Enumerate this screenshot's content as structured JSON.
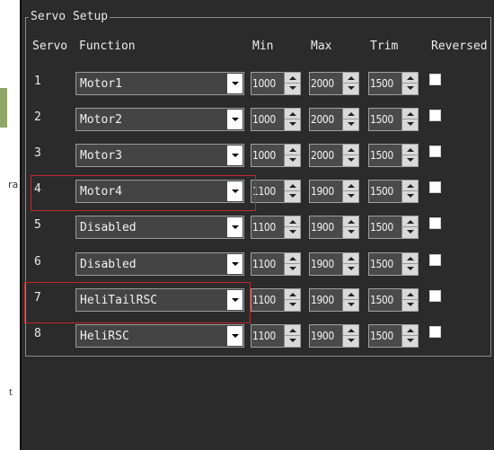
{
  "group_title": "Servo Setup",
  "headers": {
    "servo": "Servo",
    "function": "Function",
    "min": "Min",
    "max": "Max",
    "trim": "Trim",
    "reversed": "Reversed"
  },
  "rows": [
    {
      "servo": "1",
      "function": "Motor1",
      "min": "1000",
      "max": "2000",
      "trim": "1500",
      "reversed": false
    },
    {
      "servo": "2",
      "function": "Motor2",
      "min": "1000",
      "max": "2000",
      "trim": "1500",
      "reversed": false
    },
    {
      "servo": "3",
      "function": "Motor3",
      "min": "1000",
      "max": "2000",
      "trim": "1500",
      "reversed": false
    },
    {
      "servo": "4",
      "function": "Motor4",
      "min": "1100",
      "max": "1900",
      "trim": "1500",
      "reversed": false
    },
    {
      "servo": "5",
      "function": "Disabled",
      "min": "1100",
      "max": "1900",
      "trim": "1500",
      "reversed": false
    },
    {
      "servo": "6",
      "function": "Disabled",
      "min": "1100",
      "max": "1900",
      "trim": "1500",
      "reversed": false
    },
    {
      "servo": "7",
      "function": "HeliTailRSC",
      "min": "1100",
      "max": "1900",
      "trim": "1500",
      "reversed": false
    },
    {
      "servo": "8",
      "function": "HeliRSC",
      "min": "1100",
      "max": "1900",
      "trim": "1500",
      "reversed": false
    }
  ],
  "left_fragment_text": "ra",
  "left_fragment_text2": "t",
  "colors": {
    "panel_bg": "#2b2b2b",
    "highlight": "#c0282d",
    "text": "#ececec"
  }
}
